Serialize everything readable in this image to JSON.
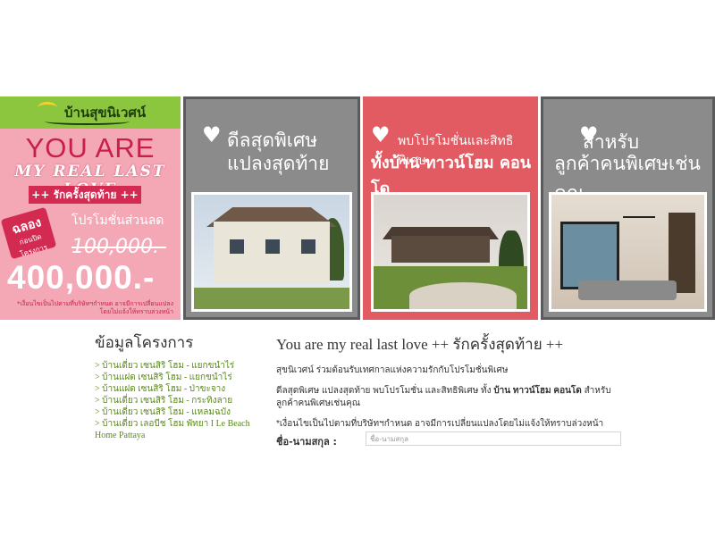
{
  "promo": {
    "logo_text": "บ้านสุขนิเวศน์",
    "you_are": "YOU ARE",
    "real_love": "MY REAL LAST LOVE",
    "last_time": "++ รักครั้งสุดท้าย ++",
    "badge_top": "ฉลอง",
    "badge_sub": "ก่อนปิดโครงการ",
    "promo_label": "โปรโมชั่นส่วนลด",
    "old_price": "100,000.-",
    "new_price": "400,000.-",
    "note": "*เงื่อนไขเป็นไปตามที่บริษัทฯกำหนด อาจมีการเปลี่ยนแปลงโดยไม่แจ้งให้ทราบล่วงหน้า"
  },
  "panels": [
    {
      "line1": "ดีลสุดพิเศษ",
      "line2": "แปลงสุดท้าย"
    },
    {
      "line1": "พบโปรโมชั่นและสิทธิพิเศษ",
      "line2": "ทั้งบ้าน ทาวน์โฮม คอนโด"
    },
    {
      "line1": "สำหรับ",
      "line2": "ลูกค้าคนพิเศษเช่นคุณ"
    }
  ],
  "sidebar": {
    "title": "ข้อมูลโครงการ",
    "items": [
      "> บ้านเดี่ยว เซนสิริ โฮม - แยกขนำไร่",
      "> บ้านแฝด เซนสิริ โฮม - แยกขนำไร่",
      "> บ้านแฝด เซนสิริ โฮม - ป่าขะจาง",
      "> บ้านเดี่ยว เซนสิริ โฮม - กระทิงลาย",
      "> บ้านเดี่ยว เซนสิริ โฮม - แหลมฉบัง",
      "> บ้านเดี่ยว เลอบีช โฮม พัทยา I Le Beach Home Pattaya"
    ]
  },
  "main": {
    "heading": "You are my real last love ++ รักครั้งสุดท้าย ++",
    "p1": "สุขนิเวศน์ ร่วมต้อนรับเทศกาลแห่งความรักกับโปรโมชั่นพิเศษ",
    "p2_a": "ดีลสุดพิเศษ แปลงสุดท้าย พบโปรโมชั่น และสิทธิพิเศษ ทั้ง ",
    "p2_b": "บ้าน ทาวน์โฮม คอนโด",
    "p2_c": " สำหรับลูกค้าคนพิเศษเช่นคุณ",
    "p3": "*เงื่อนไขเป็นไปตามที่บริษัทฯกำหนด อาจมีการเปลี่ยนแปลงโดยไม่แจ้งให้ทราบล่วงหน้า"
  },
  "form": {
    "name_label": "ชื่อ-นามสกุล :",
    "name_placeholder": "ชื่อ-นามสกุล"
  }
}
